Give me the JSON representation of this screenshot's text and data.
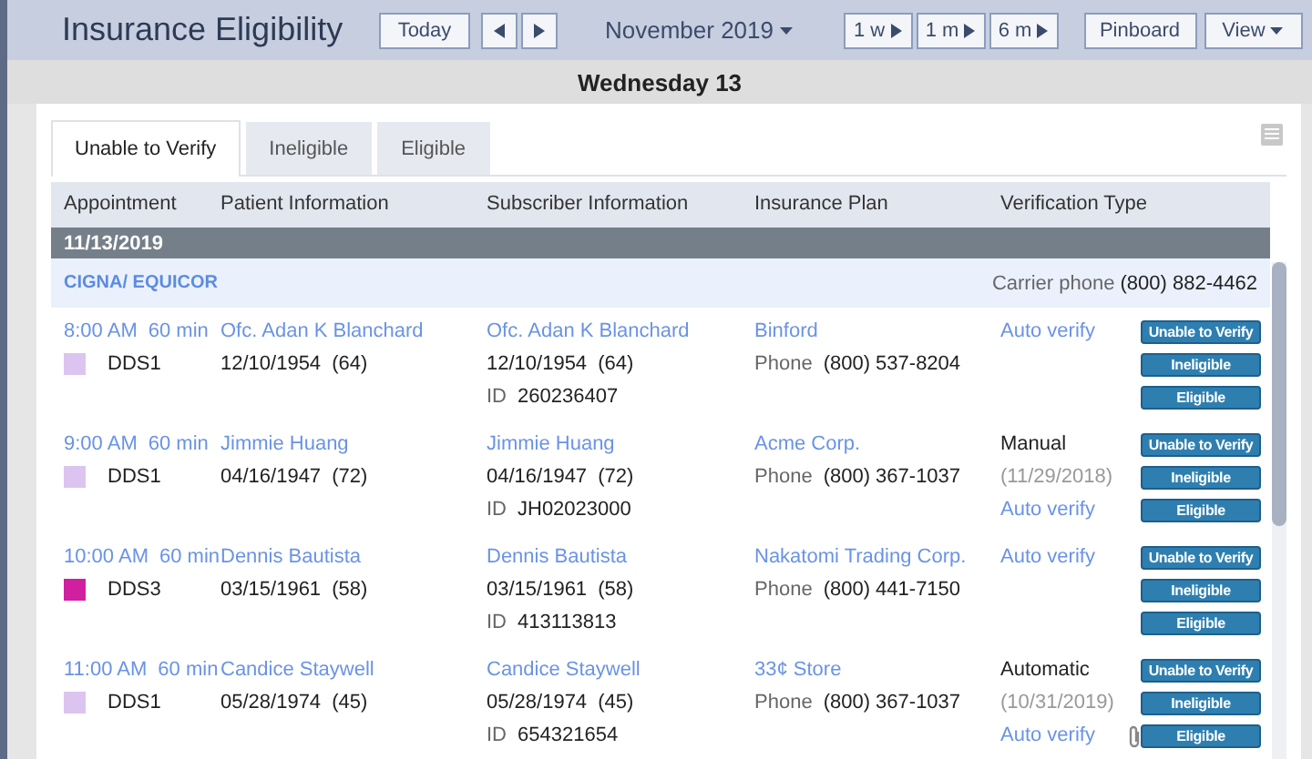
{
  "title": "Insurance Eligibility",
  "toolbar": {
    "today": "Today",
    "month": "November 2019",
    "ranges": [
      "1 w",
      "1 m",
      "6 m"
    ],
    "pinboard": "Pinboard",
    "view": "View"
  },
  "day": "Wednesday 13",
  "tabs": [
    {
      "label": "Unable to Verify",
      "selected": true
    },
    {
      "label": "Ineligible",
      "selected": false
    },
    {
      "label": "Eligible",
      "selected": false
    }
  ],
  "columns": [
    "Appointment",
    "Patient Information",
    "Subscriber Information",
    "Insurance Plan",
    "Verification Type"
  ],
  "date_group": "11/13/2019",
  "carrier": {
    "name": "CIGNA/ EQUICOR",
    "phone_label": "Carrier phone",
    "phone": "(800) 882-4462"
  },
  "rows": [
    {
      "time": "8:00 AM",
      "duration": "60 min",
      "provider": "DDS1",
      "color": "#dcc4f0",
      "patient": "Ofc. Adan K Blanchard",
      "patient_dob": "12/10/1954",
      "patient_age": "(64)",
      "subscriber": "Ofc. Adan K Blanchard",
      "subscriber_dob": "12/10/1954",
      "subscriber_age": "(64)",
      "id_label": "ID",
      "id": "260236407",
      "plan": "Binford",
      "phone_label": "Phone",
      "phone": "(800) 537-8204",
      "verification": [
        {
          "kind": "link",
          "text": "Auto verify"
        }
      ],
      "attachment": false,
      "actions": [
        "Unable to Verify",
        "Ineligible",
        "Eligible"
      ]
    },
    {
      "time": "9:00 AM",
      "duration": "60 min",
      "provider": "DDS1",
      "color": "#dcc4f0",
      "patient": "Jimmie Huang",
      "patient_dob": "04/16/1947",
      "patient_age": "(72)",
      "subscriber": "Jimmie Huang",
      "subscriber_dob": "04/16/1947",
      "subscriber_age": "(72)",
      "id_label": "ID",
      "id": "JH02023000",
      "plan": "Acme Corp.",
      "phone_label": "Phone",
      "phone": "(800) 367-1037",
      "verification": [
        {
          "kind": "text",
          "text": "Manual"
        },
        {
          "kind": "date",
          "text": "(11/29/2018)"
        },
        {
          "kind": "link",
          "text": "Auto verify"
        }
      ],
      "attachment": false,
      "actions": [
        "Unable to Verify",
        "Ineligible",
        "Eligible"
      ]
    },
    {
      "time": "10:00 AM",
      "duration": "60 min",
      "provider": "DDS3",
      "color": "#d020a0",
      "patient": "Dennis Bautista",
      "patient_dob": "03/15/1961",
      "patient_age": "(58)",
      "subscriber": "Dennis Bautista",
      "subscriber_dob": "03/15/1961",
      "subscriber_age": "(58)",
      "id_label": "ID",
      "id": "413113813",
      "plan": "Nakatomi Trading Corp.",
      "phone_label": "Phone",
      "phone": "(800) 441-7150",
      "verification": [
        {
          "kind": "link",
          "text": "Auto verify"
        }
      ],
      "attachment": false,
      "actions": [
        "Unable to Verify",
        "Ineligible",
        "Eligible"
      ]
    },
    {
      "time": "11:00 AM",
      "duration": "60 min",
      "provider": "DDS1",
      "color": "#dcc4f0",
      "patient": "Candice Staywell",
      "patient_dob": "05/28/1974",
      "patient_age": "(45)",
      "subscriber": "Candice Staywell",
      "subscriber_dob": "05/28/1974",
      "subscriber_age": "(45)",
      "id_label": "ID",
      "id": "654321654",
      "plan": "33¢ Store",
      "phone_label": "Phone",
      "phone": "(800) 367-1037",
      "verification": [
        {
          "kind": "text",
          "text": "Automatic"
        },
        {
          "kind": "date",
          "text": "(10/31/2019)"
        },
        {
          "kind": "link",
          "text": "Auto verify"
        }
      ],
      "attachment": true,
      "actions": [
        "Unable to Verify",
        "Ineligible",
        "Eligible"
      ]
    }
  ]
}
